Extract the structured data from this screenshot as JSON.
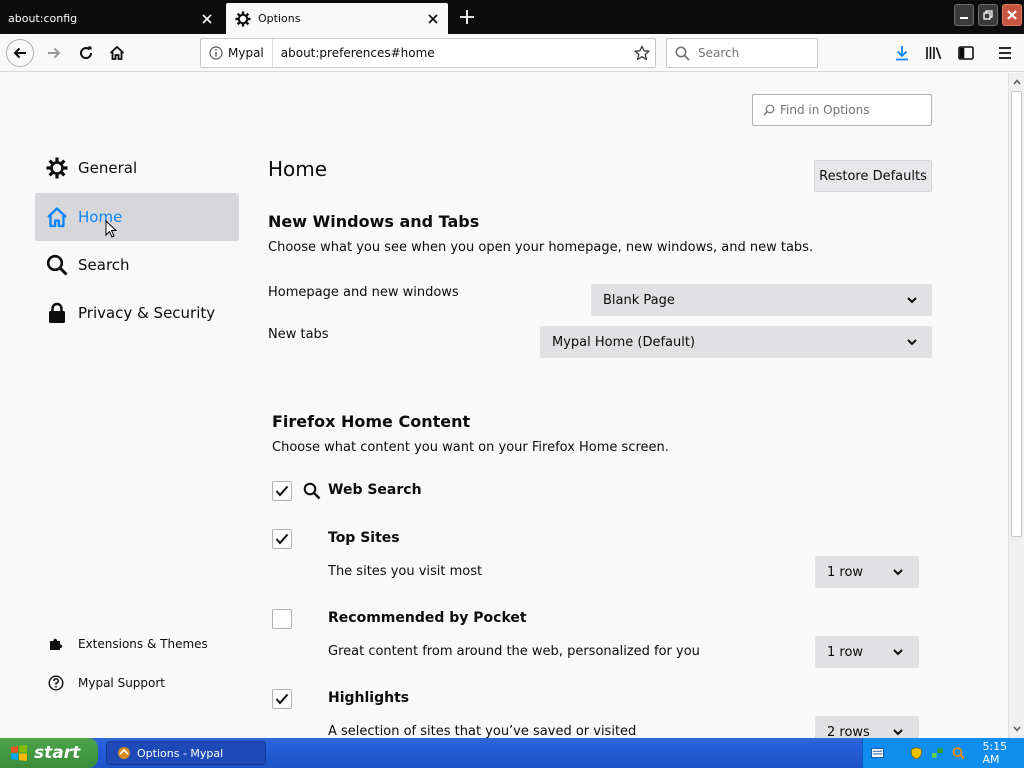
{
  "tabs": [
    {
      "label": "about:config",
      "active": false
    },
    {
      "label": "Options",
      "active": true
    }
  ],
  "urlbar": {
    "identity_label": "Mypal",
    "url": "about:preferences#home"
  },
  "searchbar": {
    "placeholder": "Search"
  },
  "find": {
    "placeholder": "Find in Options"
  },
  "sidebar": {
    "categories": [
      {
        "label": "General",
        "icon": "gear-icon"
      },
      {
        "label": "Home",
        "icon": "home-icon",
        "selected": true
      },
      {
        "label": "Search",
        "icon": "search-icon"
      },
      {
        "label": "Privacy & Security",
        "icon": "lock-icon"
      }
    ],
    "links": [
      {
        "label": "Extensions & Themes",
        "icon": "puzzle-icon"
      },
      {
        "label": "Mypal Support",
        "icon": "help-icon"
      }
    ]
  },
  "main": {
    "title": "Home",
    "restore_label": "Restore Defaults",
    "windows_section": {
      "title": "New Windows and Tabs",
      "description": "Choose what you see when you open your homepage, new windows, and new tabs.",
      "homepage_label": "Homepage and new windows",
      "homepage_value": "Blank Page",
      "newtabs_label": "New tabs",
      "newtabs_value": "Mypal Home (Default)"
    },
    "home_content": {
      "title": "Firefox Home Content",
      "description": "Choose what content you want on your Firefox Home screen.",
      "options": [
        {
          "label": "Web Search",
          "checked": true,
          "description": "",
          "rows": ""
        },
        {
          "label": "Top Sites",
          "checked": true,
          "description": "The sites you visit most",
          "rows": "1 row"
        },
        {
          "label": "Recommended by Pocket",
          "checked": false,
          "description": "Great content from around the web, personalized for you",
          "rows": "1 row"
        },
        {
          "label": "Highlights",
          "checked": true,
          "description": "A selection of sites that you’ve saved or visited",
          "rows": "2 rows"
        }
      ]
    }
  },
  "taskbar": {
    "start_label": "start",
    "task_label": "Options - Mypal",
    "clock": "5:15 AM"
  },
  "colors": {
    "accent": "#0a84ff",
    "selected_bg": "#d7d7db",
    "tabstrip_bg": "#0c0c0d"
  }
}
